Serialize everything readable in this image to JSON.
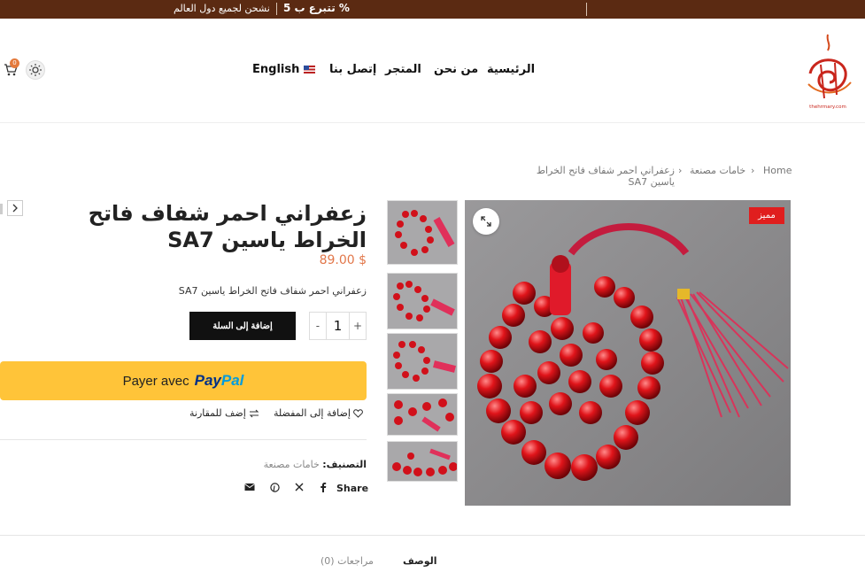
{
  "topbar": {
    "shipping": "نشحن لجميع دول العالم",
    "donation": "تتبرع ب 5 %"
  },
  "header": {
    "cart_count": "0",
    "nav": [
      "الرئيسية",
      "من نحن",
      "المتجر",
      "إتصل بنا"
    ],
    "language": "English",
    "logo_caption": "thehrmary.com"
  },
  "breadcrumb": {
    "home": "Home",
    "category": "خامات مصنعة",
    "current": "زعفراني احمر شفاف فاتح الخراط ياسين SA7",
    "sep": "›"
  },
  "gallery": {
    "badge": "مميز"
  },
  "product": {
    "title": "زعفراني احمر شفاف فاتح الخراط ياسين SA7",
    "price": "89.00 $",
    "short_description": "زعفراني احمر شفاف فاتح الخراط ياسين SA7",
    "qty_minus": "-",
    "qty_value": "1",
    "qty_plus": "+",
    "add_to_cart": "إضافة إلى السلة"
  },
  "paypal": {
    "prefix": "Payer avec",
    "brand_pay": "Pay",
    "brand_pal": "Pal"
  },
  "actions": {
    "wishlist": "إضافة إلى المفضلة",
    "compare": "إضف للمقارنة"
  },
  "meta": {
    "category_label": "التصنيف:",
    "category_value": "خامات مصنعة",
    "share_label": "Share"
  },
  "tabs": {
    "description": "الوصف",
    "reviews": "مراجعات (0)"
  },
  "colors": {
    "topbar": "#5b2a12",
    "accent": "#e2774a",
    "badge": "#e01e1e",
    "paypal": "#ffc439"
  }
}
